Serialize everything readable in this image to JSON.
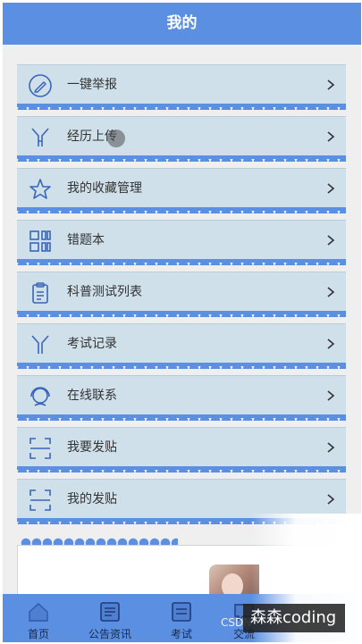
{
  "header": {
    "title": "我的"
  },
  "menu": [
    {
      "label": "一键举报",
      "icon": "pencil-circle-icon"
    },
    {
      "label": "经历上传",
      "icon": "upload-fork-icon"
    },
    {
      "label": "我的收藏管理",
      "icon": "star-icon"
    },
    {
      "label": "错题本",
      "icon": "grid-icon"
    },
    {
      "label": "科普测试列表",
      "icon": "clipboard-icon"
    },
    {
      "label": "考试记录",
      "icon": "fork-icon"
    },
    {
      "label": "在线联系",
      "icon": "headset-icon"
    },
    {
      "label": "我要发贴",
      "icon": "scan-frame-icon"
    },
    {
      "label": "我的发贴",
      "icon": "scan-frame-icon"
    }
  ],
  "tabbar": [
    {
      "label": "首页",
      "icon": "home-icon"
    },
    {
      "label": "公告资讯",
      "icon": "news-icon"
    },
    {
      "label": "考试",
      "icon": "exam-icon"
    },
    {
      "label": "交流",
      "icon": "chat-icon"
    }
  ],
  "watermark": {
    "text": "森森coding",
    "csdn": "CSDN"
  },
  "colors": {
    "primary": "#5a8fe2",
    "item_bg": "#cfe0ea",
    "icon": "#3a66b8"
  }
}
